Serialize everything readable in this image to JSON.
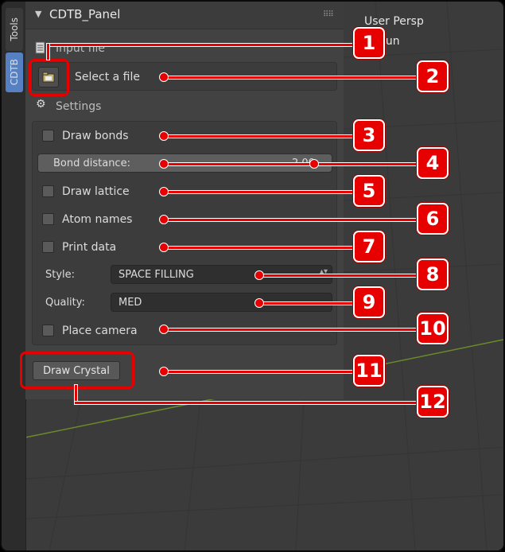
{
  "tabs": {
    "tools": "Tools",
    "cdtb": "CDTB"
  },
  "viewport": {
    "view_label": "User Persp",
    "object_label": "Sun"
  },
  "panel": {
    "title": "CDTB_Panel",
    "input_file_label": "Input file",
    "select_file_label": "Select a file",
    "settings_label": "Settings",
    "draw_bonds": {
      "label": "Draw bonds",
      "checked": false
    },
    "bond_distance": {
      "label": "Bond distance:",
      "value": "2.00"
    },
    "draw_lattice": {
      "label": "Draw lattice",
      "checked": false
    },
    "atom_names": {
      "label": "Atom names",
      "checked": false
    },
    "print_data": {
      "label": "Print data",
      "checked": false
    },
    "style": {
      "label": "Style:",
      "value": "SPACE FILLING"
    },
    "quality": {
      "label": "Quality:",
      "value": "MED"
    },
    "place_camera": {
      "label": "Place camera",
      "checked": false
    },
    "draw_crystal_label": "Draw Crystal"
  },
  "callouts": [
    "1",
    "2",
    "3",
    "4",
    "5",
    "6",
    "7",
    "8",
    "9",
    "10",
    "11",
    "12"
  ],
  "colors": {
    "callout_red": "#e60000",
    "tab_active": "#5680c2"
  }
}
